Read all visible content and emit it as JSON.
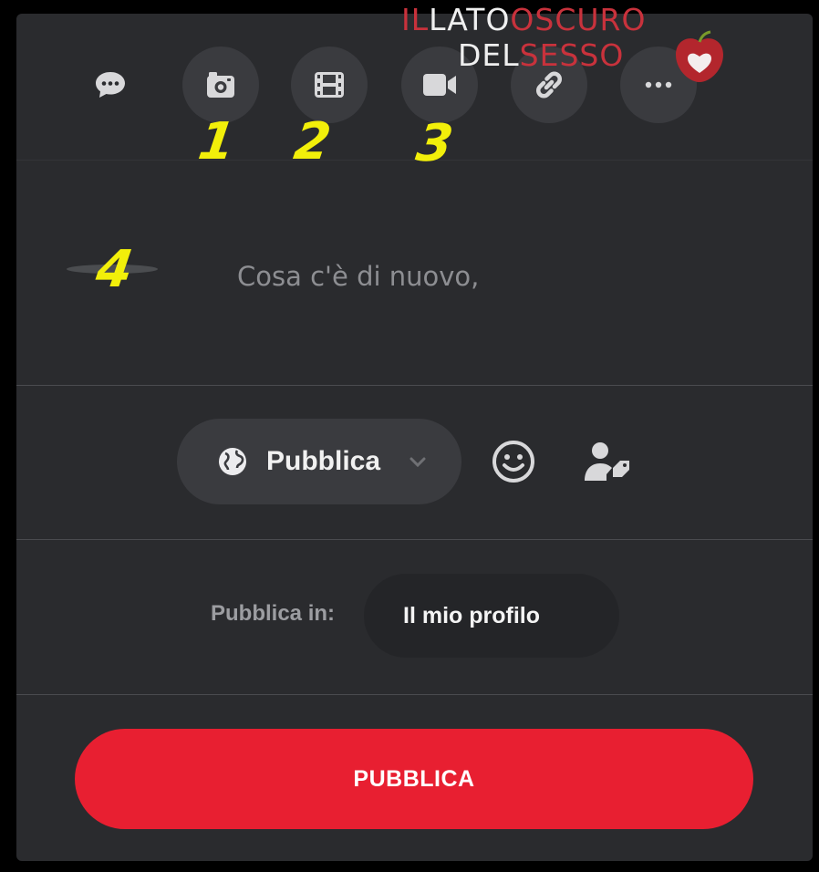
{
  "watermark": {
    "line1_red": "IL",
    "line1_white": "LATO",
    "line1_red2": "OSCURO",
    "line2_white": "DEL",
    "line2_red": "SESSO"
  },
  "toolbar": {
    "buttons": [
      {
        "name": "status",
        "icon": "speech-bubble-icon"
      },
      {
        "name": "photo",
        "icon": "camera-icon"
      },
      {
        "name": "gallery",
        "icon": "film-icon"
      },
      {
        "name": "video",
        "icon": "video-camera-icon"
      },
      {
        "name": "link",
        "icon": "link-icon"
      },
      {
        "name": "more",
        "icon": "more-dots-icon"
      }
    ]
  },
  "annotations": [
    "1",
    "2",
    "3",
    "4"
  ],
  "composer": {
    "placeholder": "Cosa c'è di nuovo,"
  },
  "privacy": {
    "label": "Pubblica",
    "icon": "globe-icon"
  },
  "publish_in": {
    "label": "Pubblica in:",
    "value": "Il mio profilo"
  },
  "submit": {
    "label": "PUBBLICA"
  },
  "colors": {
    "panel": "#2a2b2e",
    "button_bg": "#3a3b3f",
    "accent": "#e81f31",
    "annotation": "#f2ef0a"
  }
}
